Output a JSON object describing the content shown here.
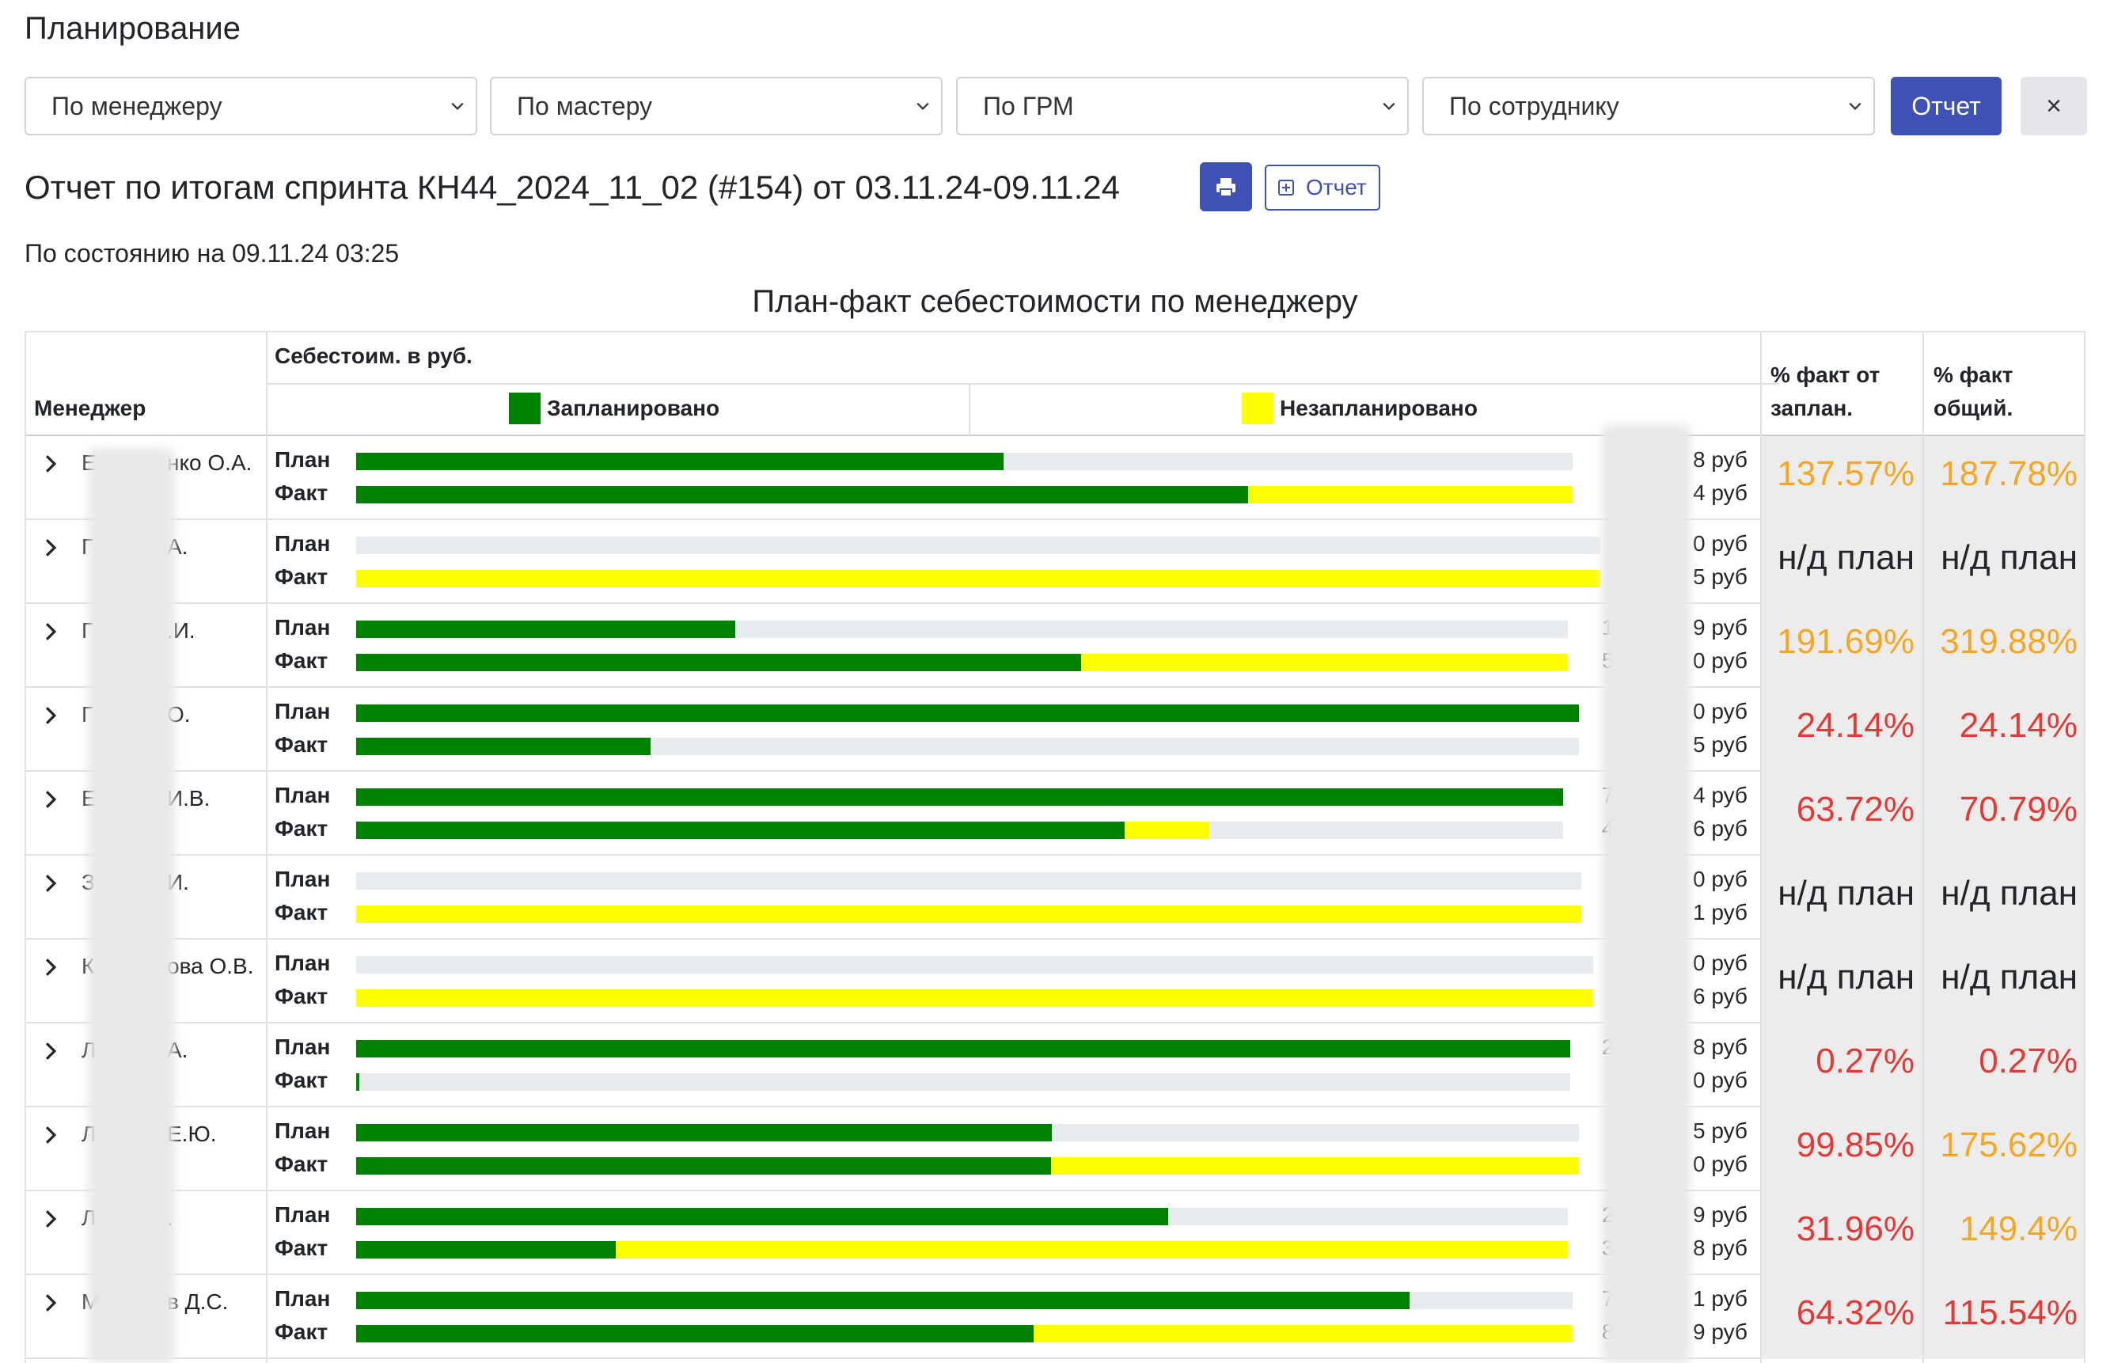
{
  "page": {
    "title": "Планирование"
  },
  "filters": {
    "manager": "По менеджеру",
    "master": "По мастеру",
    "grm": "По ГРМ",
    "employee": "По сотруднику",
    "report_button": "Отчет",
    "close_button": "×"
  },
  "report": {
    "title": "Отчет по итогам спринта КН44_2024_11_02 (#154) от 03.11.24-09.11.24",
    "export_button": "Отчет",
    "status": "По состоянию на 09.11.24 03:25",
    "chart_title": "План-факт себестоимости по менеджеру"
  },
  "table": {
    "col_manager": "Менеджер",
    "col_cost": "Себестоим. в руб.",
    "legend_planned": "Запланировано",
    "legend_unplanned": "Незапланировано",
    "col_pct_plan_1": "% факт от",
    "col_pct_plan_2": "заплан.",
    "col_pct_total_1": "% факт",
    "col_pct_total_2": "общий.",
    "plan_label": "План",
    "fact_label": "Факт"
  },
  "colors": {
    "planned": "#008000",
    "unplanned": "#ffff00",
    "track": "#e9ecef",
    "pct_orange": "#f5a623",
    "pct_red": "#e53935",
    "pct_dark": "#212529",
    "accent": "#3f51b5"
  },
  "chart_data": {
    "type": "bar",
    "description_series": [
      "План",
      "Факт"
    ],
    "rows": [
      {
        "name_visible": "Е нко О.А.",
        "name_left": "Е",
        "name_right": "нко О.А.",
        "plan_rub": "8 руб",
        "fact_rub": "4 руб",
        "lead_plan": "",
        "lead_fact": "",
        "track": 0.978,
        "plan_green": 0.532,
        "fact_green": 0.733,
        "fact_yellow": 0.267,
        "pct_plan": "137.57%",
        "pct_plan_color": "orange",
        "pct_total": "187.78%",
        "pct_total_color": "orange"
      },
      {
        "name_visible": "Г А.",
        "name_left": "Г",
        "name_right": "А.",
        "plan_rub": "0 руб",
        "fact_rub": "5 руб",
        "lead_plan": "",
        "lead_fact": "",
        "track": 1.0,
        "plan_green": 0,
        "fact_green": 0,
        "fact_yellow": 1.0,
        "pct_plan": "н/д план",
        "pct_plan_color": "dark",
        "pct_total": "н/д план",
        "pct_total_color": "dark"
      },
      {
        "name_visible": "Г .И.",
        "name_left": "Г",
        "name_right": ".И.",
        "plan_rub": "9 руб",
        "fact_rub": "0 руб",
        "lead_plan": "1",
        "lead_fact": "5",
        "track": 0.974,
        "plan_green": 0.313,
        "fact_green": 0.598,
        "fact_yellow": 0.402,
        "pct_plan": "191.69%",
        "pct_plan_color": "orange",
        "pct_total": "319.88%",
        "pct_total_color": "orange"
      },
      {
        "name_visible": "Г О.",
        "name_left": "Г",
        "name_right": "О.",
        "plan_rub": "0 руб",
        "fact_rub": "5 руб",
        "lead_plan": "",
        "lead_fact": "",
        "track": 0.983,
        "plan_green": 1.0,
        "fact_green": 0.241,
        "fact_yellow": 0,
        "pct_plan": "24.14%",
        "pct_plan_color": "red",
        "pct_total": "24.14%",
        "pct_total_color": "red"
      },
      {
        "name_visible": "Е И.В.",
        "name_left": "Е",
        "name_right": "И.В.",
        "plan_rub": "4 руб",
        "fact_rub": "6 руб",
        "lead_plan": "7",
        "lead_fact": "4",
        "track": 0.97,
        "plan_green": 1.0,
        "fact_green": 0.637,
        "fact_yellow": 0.07,
        "pct_plan": "63.72%",
        "pct_plan_color": "red",
        "pct_total": "70.79%",
        "pct_total_color": "red"
      },
      {
        "name_visible": "З И.",
        "name_left": "З",
        "name_right": "И.",
        "plan_rub": "0 руб",
        "fact_rub": "1 руб",
        "lead_plan": "",
        "lead_fact": "",
        "track": 0.985,
        "plan_green": 0,
        "fact_green": 0,
        "fact_yellow": 1.0,
        "pct_plan": "н/д план",
        "pct_plan_color": "dark",
        "pct_total": "н/д план",
        "pct_total_color": "dark"
      },
      {
        "name_visible": "К ова О.В.",
        "name_left": "К",
        "name_right": "ова О.В.",
        "plan_rub": "0 руб",
        "fact_rub": "6 руб",
        "lead_plan": "",
        "lead_fact": "",
        "track": 0.994,
        "plan_green": 0,
        "fact_green": 0,
        "fact_yellow": 1.0,
        "pct_plan": "н/д план",
        "pct_plan_color": "dark",
        "pct_total": "н/д план",
        "pct_total_color": "dark"
      },
      {
        "name_visible": "Л А.",
        "name_left": "Л",
        "name_right": "А.",
        "plan_rub": "8 руб",
        "fact_rub": "0 руб",
        "lead_plan": "2",
        "lead_fact": "",
        "track": 0.976,
        "plan_green": 1.0,
        "fact_green": 0.0027,
        "fact_yellow": 0,
        "pct_plan": "0.27%",
        "pct_plan_color": "red",
        "pct_total": "0.27%",
        "pct_total_color": "red"
      },
      {
        "name_visible": "Л Е.Ю.",
        "name_left": "Л",
        "name_right": "Е.Ю.",
        "plan_rub": "5 руб",
        "fact_rub": "0 руб",
        "lead_plan": "",
        "lead_fact": "",
        "track": 0.983,
        "plan_green": 0.569,
        "fact_green": 0.568,
        "fact_yellow": 0.432,
        "pct_plan": "99.85%",
        "pct_plan_color": "red",
        "pct_total": "175.62%",
        "pct_total_color": "orange"
      },
      {
        "name_visible": "Л .",
        "name_left": "Л",
        "name_right": ".",
        "plan_rub": "9 руб",
        "fact_rub": "8 руб",
        "lead_plan": "2",
        "lead_fact": "3",
        "track": 0.974,
        "plan_green": 0.67,
        "fact_green": 0.214,
        "fact_yellow": 0.786,
        "pct_plan": "31.96%",
        "pct_plan_color": "red",
        "pct_total": "149.4%",
        "pct_total_color": "orange"
      },
      {
        "name_visible": "М в Д.С.",
        "name_left": "М",
        "name_right": "в Д.С.",
        "plan_rub": "1 руб",
        "fact_rub": "9 руб",
        "lead_plan": "7",
        "lead_fact": "8",
        "track": 0.978,
        "plan_green": 0.866,
        "fact_green": 0.557,
        "fact_yellow": 0.443,
        "pct_plan": "64.32%",
        "pct_plan_color": "red",
        "pct_total": "115.54%",
        "pct_total_color": "red"
      }
    ]
  }
}
